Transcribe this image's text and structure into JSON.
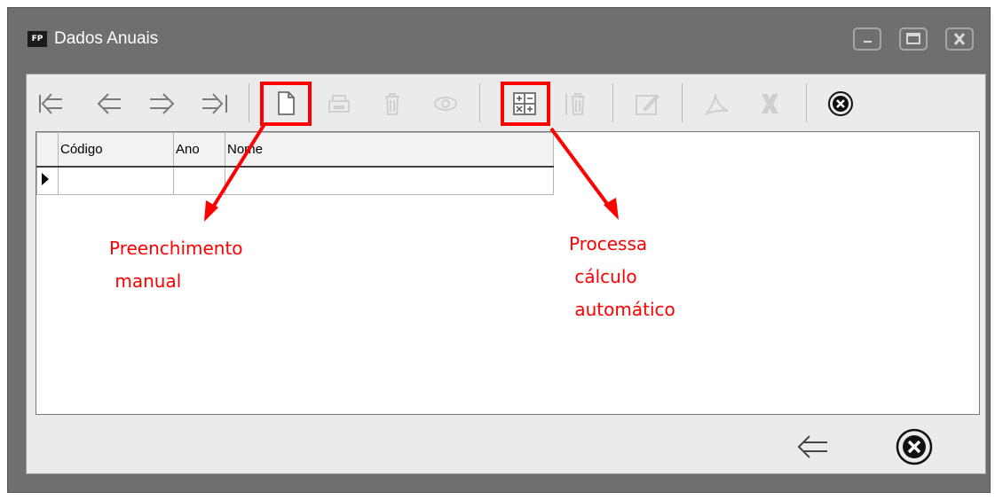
{
  "window": {
    "app_icon_text": "FP",
    "title": "Dados Anuais",
    "controls": [
      "minimize-icon",
      "maximize-icon",
      "close-icon"
    ]
  },
  "toolbar": {
    "buttons": [
      {
        "icon": "first-record-icon",
        "enabled": true
      },
      {
        "icon": "previous-record-icon",
        "enabled": true
      },
      {
        "icon": "next-record-icon",
        "enabled": true
      },
      {
        "icon": "last-record-icon",
        "enabled": true
      },
      {
        "icon": "new-document-icon",
        "enabled": true,
        "highlighted": true
      },
      {
        "icon": "print-icon",
        "enabled": false
      },
      {
        "icon": "trash-icon",
        "enabled": false
      },
      {
        "icon": "eye-icon",
        "enabled": false
      },
      {
        "icon": "calculator-icon",
        "enabled": true,
        "highlighted": true
      },
      {
        "icon": "delete-icon",
        "enabled": false
      },
      {
        "icon": "edit-icon",
        "enabled": false
      },
      {
        "icon": "pdf-icon",
        "enabled": false
      },
      {
        "icon": "excel-icon",
        "enabled": false
      },
      {
        "icon": "close-circle-icon",
        "enabled": true
      }
    ]
  },
  "grid": {
    "columns": [
      "Código",
      "Ano",
      "Nome"
    ],
    "rows": [
      [
        "",
        "",
        ""
      ]
    ]
  },
  "annotations": {
    "manual": "Preenchimento\n manual",
    "auto": "Processa\n cálculo\n automático",
    "color": "#ff0000"
  },
  "bottom": {
    "buttons": [
      "back-arrow-icon",
      "close-circle-icon"
    ]
  }
}
